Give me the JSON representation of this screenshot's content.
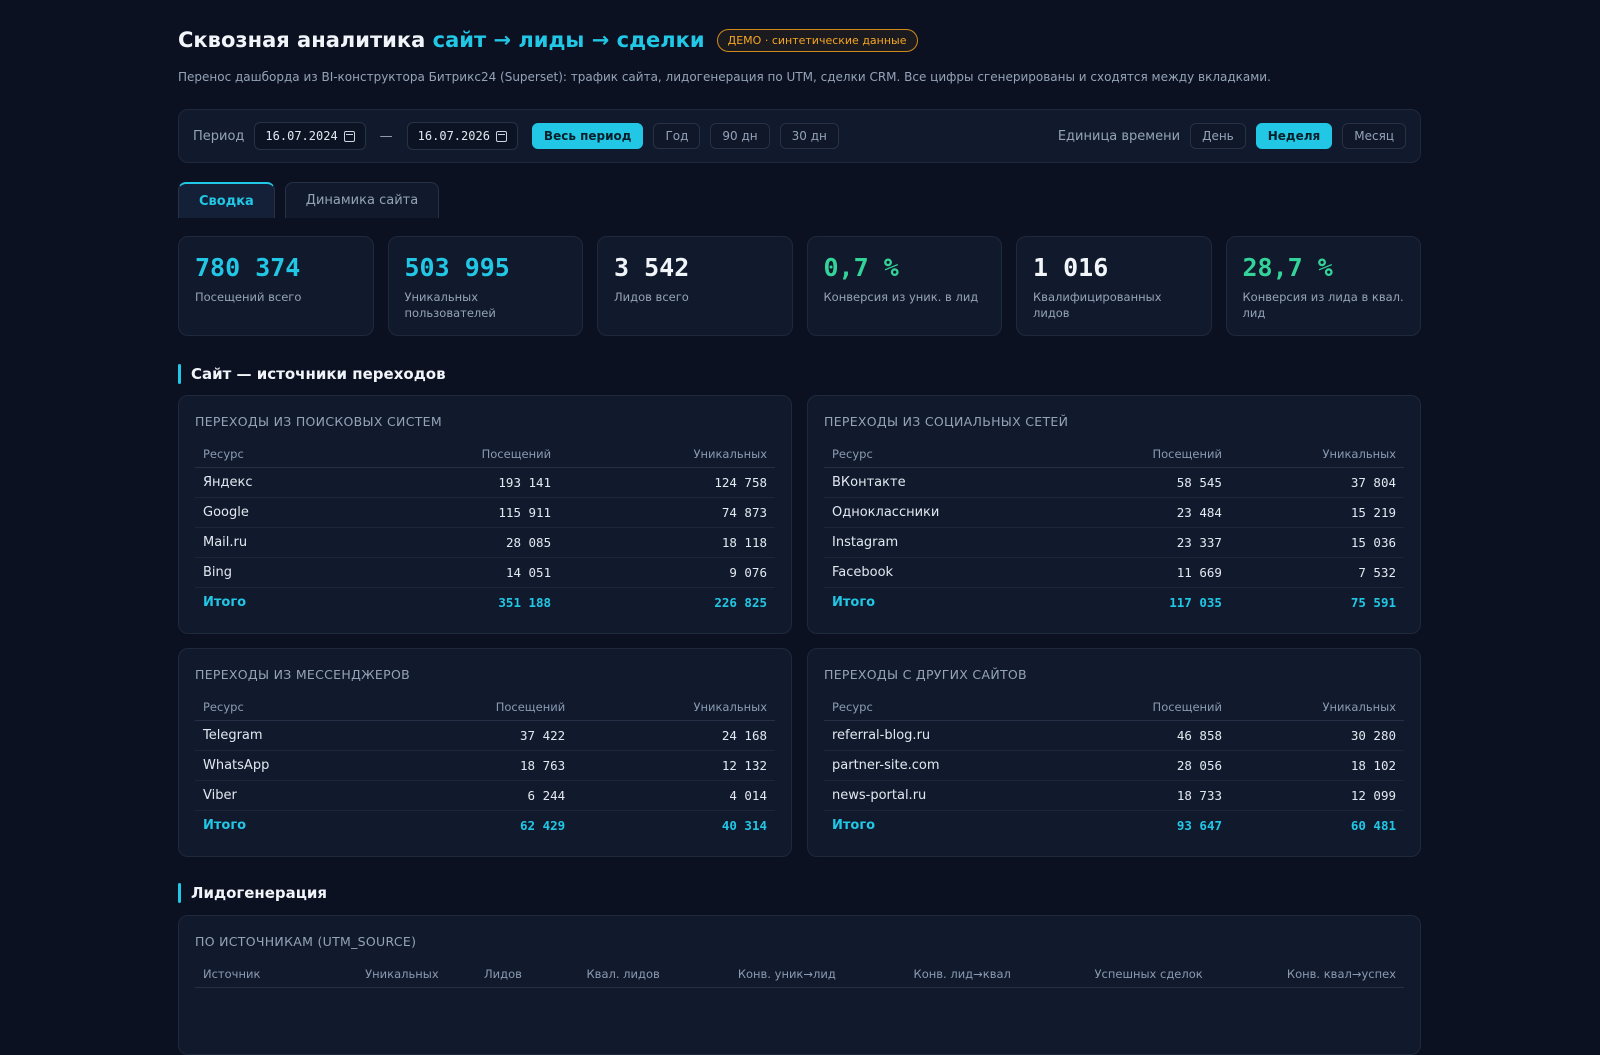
{
  "header": {
    "title_main": "Сквозная аналитика",
    "title_accent": "сайт → лиды → сделки",
    "badge": "ДЕМО · синтетические данные",
    "subtitle": "Перенос дашборда из BI-конструктора Битрикс24 (Superset): трафик сайта, лидогенерация по UTM, сделки CRM. Все цифры сгенерированы и сходятся между вкладками."
  },
  "filters": {
    "period_label": "Период",
    "date_from": "16.07.2024",
    "date_sep": "—",
    "date_to": "16.07.2026",
    "ranges": [
      "Весь период",
      "Год",
      "90 дн",
      "30 дн"
    ],
    "range_active": "Весь период",
    "unit_label": "Единица времени",
    "units": [
      "День",
      "Неделя",
      "Месяц"
    ],
    "unit_active": "Неделя"
  },
  "tabs": [
    "Сводка",
    "Динамика сайта"
  ],
  "tab_active": "Сводка",
  "kpis": [
    {
      "value": "780 374",
      "label": "Посещений всего",
      "color": "#22c7e6"
    },
    {
      "value": "503 995",
      "label": "Уникальных пользователей",
      "color": "#22c7e6"
    },
    {
      "value": "3 542",
      "label": "Лидов всего",
      "color": "#f1f5f9"
    },
    {
      "value": "0,7 %",
      "label": "Конверсия из уник. в лид",
      "color": "#34d399"
    },
    {
      "value": "1 016",
      "label": "Квалифицированных лидов",
      "color": "#f1f5f9"
    },
    {
      "value": "28,7 %",
      "label": "Конверсия из лида в квал. лид",
      "color": "#34d399"
    }
  ],
  "section_site": "Сайт — источники переходов",
  "columns": [
    "Ресурс",
    "Посещений",
    "Уникальных"
  ],
  "search": {
    "title": "ПЕРЕХОДЫ ИЗ ПОИСКОВЫХ СИСТЕМ",
    "rows": [
      [
        "Яндекс",
        "193 141",
        "124 758"
      ],
      [
        "Google",
        "115 911",
        "74 873"
      ],
      [
        "Mail.ru",
        "28 085",
        "18 118"
      ],
      [
        "Bing",
        "14 051",
        "9 076"
      ]
    ],
    "total": [
      "Итого",
      "351 188",
      "226 825"
    ]
  },
  "social": {
    "title": "ПЕРЕХОДЫ ИЗ СОЦИАЛЬНЫХ СЕТЕЙ",
    "rows": [
      [
        "ВКонтакте",
        "58 545",
        "37 804"
      ],
      [
        "Одноклассники",
        "23 484",
        "15 219"
      ],
      [
        "Instagram",
        "23 337",
        "15 036"
      ],
      [
        "Facebook",
        "11 669",
        "7 532"
      ]
    ],
    "total": [
      "Итого",
      "117 035",
      "75 591"
    ]
  },
  "messengers": {
    "title": "ПЕРЕХОДЫ ИЗ МЕССЕНДЖЕРОВ",
    "rows": [
      [
        "Telegram",
        "37 422",
        "24 168"
      ],
      [
        "WhatsApp",
        "18 763",
        "12 132"
      ],
      [
        "Viber",
        "6 244",
        "4 014"
      ]
    ],
    "total": [
      "Итого",
      "62 429",
      "40 314"
    ]
  },
  "other_sites": {
    "title": "ПЕРЕХОДЫ С ДРУГИХ САЙТОВ",
    "rows": [
      [
        "referral-blog.ru",
        "46 858",
        "30 280"
      ],
      [
        "partner-site.com",
        "28 056",
        "18 102"
      ],
      [
        "news-portal.ru",
        "18 733",
        "12 099"
      ]
    ],
    "total": [
      "Итого",
      "93 647",
      "60 481"
    ]
  },
  "section_leads": "Лидогенерация",
  "utm": {
    "title": "ПО ИСТОЧНИКАМ (UTM_SOURCE)",
    "columns": [
      "Источник",
      "Уникальных",
      "Лидов",
      "Квал. лидов",
      "Конв. уник→лид",
      "Конв. лид→квал",
      "Успешных сделок",
      "Конв. квал→успех"
    ]
  }
}
